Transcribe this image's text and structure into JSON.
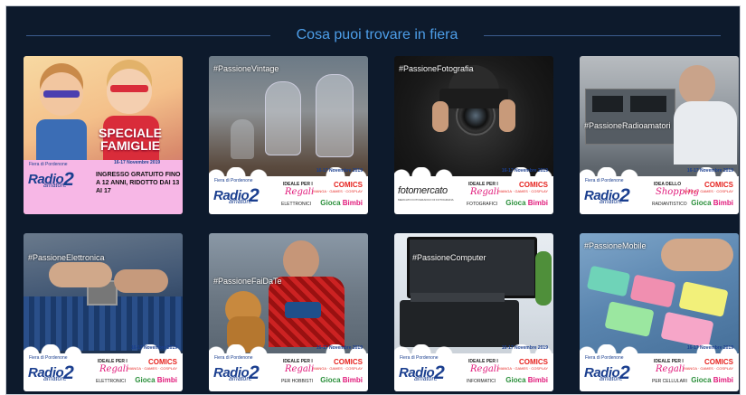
{
  "section_title": "Cosa puoi trovare in fiera",
  "brand": {
    "fiera": "Fiera di Pordenone",
    "radio": "Radio",
    "two": "2",
    "amatore": "amatore",
    "date": "16-17 Novembre 2019",
    "ideale": "IDEALE PER I",
    "regali": "Regali",
    "comics": "COMICS",
    "comics_sub": "MANGA · GAMES · COSPLAY",
    "gioca": "Gioca",
    "bimbi": "Bimbi"
  },
  "cards": [
    {
      "tag": "",
      "headline": "SPECIALE FAMIGLIE",
      "promo": "INGRESSO GRATUITO FINO A 12 ANNI, RIDOTTO DAI 13 AI 17"
    },
    {
      "tag": "#PassioneVintage",
      "category": "ELETTRONICI"
    },
    {
      "tag": "#PassioneFotografia",
      "category": "FOTOGRAFICI",
      "sponsor": "fotomercato",
      "sponsor_sub": "MERCATO FOTOGRAFICO DI FOTOGRAFIA"
    },
    {
      "tag": "#PassioneRadioamatori",
      "category": "RADIANTISTICO",
      "ideale": "IDEA DELLO",
      "regali": "Shopping"
    },
    {
      "tag": "#PassioneElettronica",
      "category": "ELETTRONICI"
    },
    {
      "tag": "#PassioneFaiDaTe",
      "category": "PER HOBBISTI"
    },
    {
      "tag": "#PassioneComputer",
      "category": "INFORMATICI"
    },
    {
      "tag": "#PassioneMobile",
      "category": "PER CELLULARI"
    }
  ]
}
